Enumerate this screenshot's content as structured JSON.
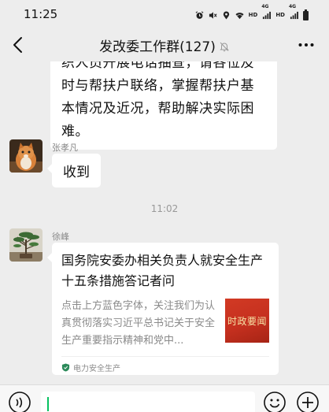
{
  "status_bar": {
    "time": "11:25",
    "network_1": "HD",
    "gen_1": "4G",
    "network_2": "HD",
    "gen_2": "4G",
    "icons": [
      "alarm-icon",
      "mute-icon",
      "location-icon",
      "wifi-icon",
      "signal-icon",
      "signal-icon",
      "battery-icon"
    ]
  },
  "header": {
    "title": "发改委工作群(127)",
    "icons": [
      "back-arrow-icon",
      "mute-bell-icon",
      "more-dots-icon"
    ]
  },
  "messages": [
    {
      "type": "text",
      "text": "织人员开展电话抽查，请各位及时与帮扶户联络，掌握帮扶户基本情况及近况，帮助解决实际困难。"
    },
    {
      "type": "text",
      "sender": "张孝凡",
      "text": "收到"
    },
    {
      "type": "time",
      "text": "11:02"
    },
    {
      "type": "link-card",
      "sender": "徐峰",
      "title": "国务院安委办相关负责人就安全生产十五条措施答记者问",
      "description": "点击上方蓝色字体，关注我们为认真贯彻落实习近平总书记关于安全生产重要指示精神和党中...",
      "thumbnail_text": "时政要闻",
      "source": "电力安全生产"
    }
  ],
  "input_bar": {
    "icons": [
      "voice-icon",
      "emoji-icon",
      "plus-icon"
    ]
  },
  "colors": {
    "background": "#ededed",
    "bubble": "#ffffff",
    "accent": "#07c160",
    "thumbnail": "#c5301f"
  }
}
